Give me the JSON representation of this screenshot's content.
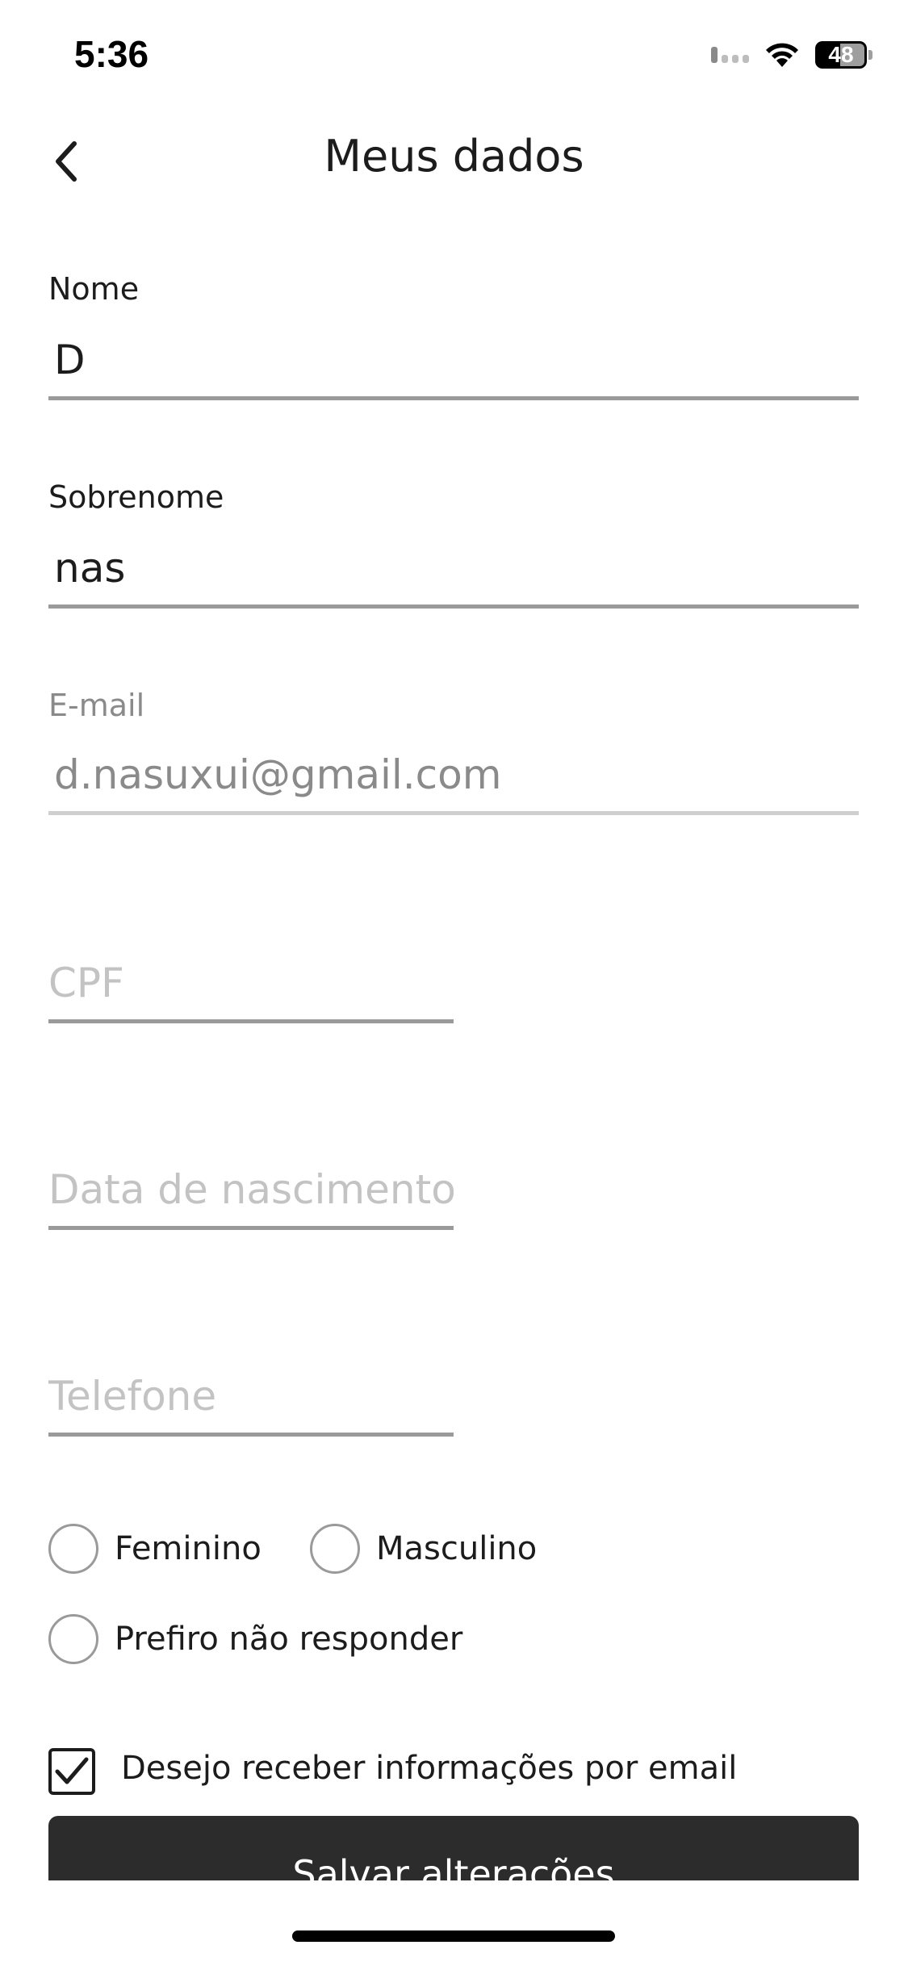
{
  "status_bar": {
    "time": "5:36",
    "battery": "48",
    "icons": [
      "signal-icon",
      "wifi-icon",
      "battery-icon"
    ]
  },
  "header": {
    "title": "Meus dados",
    "back_icon": "chevron-left-icon"
  },
  "form": {
    "nome": {
      "label": "Nome",
      "value": "D"
    },
    "sobrenome": {
      "label": "Sobrenome",
      "value": "nas"
    },
    "email": {
      "label": "E-mail",
      "value": "d.nasuxui@gmail.com"
    },
    "cpf": {
      "placeholder": "CPF"
    },
    "nascimento": {
      "placeholder": "Data de nascimento"
    },
    "telefone": {
      "placeholder": "Telefone"
    }
  },
  "gender": {
    "options": [
      "Feminino",
      "Masculino",
      "Prefiro não responder"
    ],
    "selected": null
  },
  "newsletter": {
    "label": "Desejo receber informações por email",
    "checked": true
  },
  "save_button": {
    "label": "Salvar alterações"
  },
  "colors": {
    "text": "#1c1c1c",
    "muted": "#8a8a8a",
    "placeholder": "#c3c3c3",
    "underline": "#9a9a9a",
    "button": "#2c2c2c"
  }
}
